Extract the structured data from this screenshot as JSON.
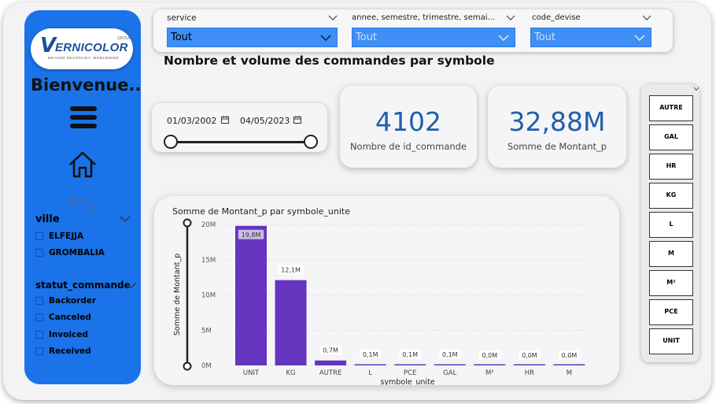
{
  "sidebar": {
    "logo": {
      "letter": "V",
      "brand": "ERNICOLOR",
      "group": "GROUP",
      "tagline": "BEYOND DECOPAINT, WORLDWIDE"
    },
    "welcome": "Bienvenue..",
    "ville": {
      "title": "ville",
      "items": [
        "ELFEJJA",
        "GROMBALIA"
      ]
    },
    "statut": {
      "title": "statut_commande",
      "items": [
        "Backorder",
        "Canceled",
        "Invoiced",
        "Received"
      ]
    }
  },
  "filters": [
    {
      "label": "service",
      "value": "Tout"
    },
    {
      "label": "annee, semestre, trimestre, semai...",
      "value": "Tout"
    },
    {
      "label": "code_devise",
      "value": "Tout"
    }
  ],
  "page_title": "Nombre et volume des commandes par symbole",
  "date_range": {
    "start": "01/03/2002",
    "end": "04/05/2023"
  },
  "kpis": [
    {
      "value": "4102",
      "label": "Nombre de id_commande"
    },
    {
      "value": "32,88M",
      "label": "Somme de Montant_p"
    }
  ],
  "symbols": [
    "AUTRE",
    "GAL",
    "HR",
    "KG",
    "L",
    "M",
    "M²",
    "PCE",
    "UNIT"
  ],
  "chart_data": {
    "type": "bar",
    "title": "Somme de Montant_p par symbole_unite",
    "xlabel": "symbole_unite",
    "ylabel": "Somme de Montant_p",
    "categories": [
      "UNIT",
      "KG",
      "AUTRE",
      "L",
      "PCE",
      "GAL",
      "M²",
      "HR",
      "M"
    ],
    "values": [
      19.8,
      12.1,
      0.7,
      0.1,
      0.1,
      0.1,
      0.0,
      0.0,
      0.0
    ],
    "data_labels": [
      "19,8M",
      "12,1M",
      "0,7M",
      "0,1M",
      "0,1M",
      "0,1M",
      "0,0M",
      "0,0M",
      "0,0M"
    ],
    "yticks": [
      "0M",
      "5M",
      "10M",
      "15M",
      "20M"
    ],
    "ylim": [
      0,
      20
    ],
    "bar_color": "#6535c0"
  },
  "colors": {
    "sidebar": "#1a73e8",
    "kpi": "#1f5fab",
    "select": "#3f8ff5"
  }
}
